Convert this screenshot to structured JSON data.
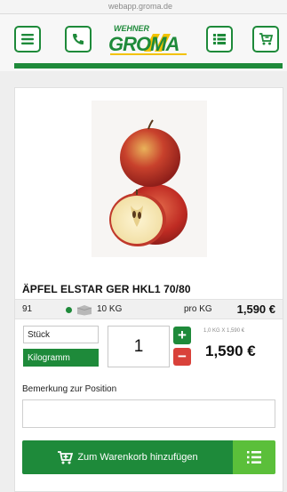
{
  "browser": {
    "url": "webapp.groma.de"
  },
  "header": {
    "logo_top": "WEHNER",
    "logo_main": "GROMA",
    "menu_icon": "menu-icon",
    "phone_icon": "phone-icon",
    "list_icon": "list-icon",
    "cart_icon": "cart-icon"
  },
  "product": {
    "title": "ÄPFEL ELSTAR GER HKL1 70/80",
    "article_number": "91",
    "weight": "10 KG",
    "price_unit": "pro KG",
    "price": "1,590 €"
  },
  "order": {
    "units": [
      "Stück",
      "Kilogramm"
    ],
    "selected_unit": "Kilogramm",
    "quantity": "1",
    "plus_label": "+",
    "minus_label": "−",
    "calculation": "1,0 KG X 1,590 €",
    "total": "1,590 €"
  },
  "remark": {
    "label": "Bemerkung zur Position",
    "value": ""
  },
  "actions": {
    "add_to_cart": "Zum Warenkorb hinzufügen"
  },
  "colors": {
    "primary": "#1e8a3a",
    "accent": "#5bbf3a",
    "danger": "#d9413a",
    "logo_yellow": "#f2c200"
  }
}
